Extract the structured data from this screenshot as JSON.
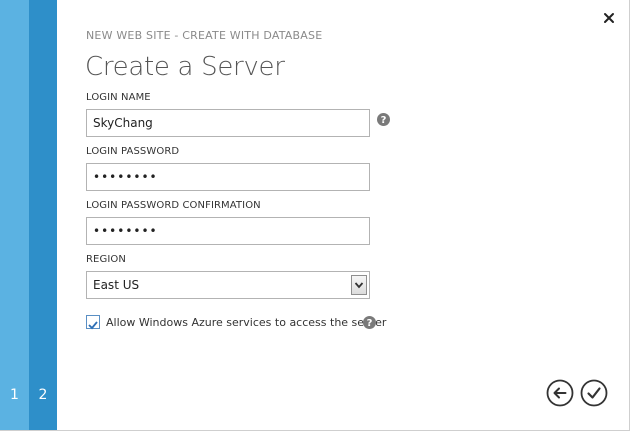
{
  "wizard": {
    "subtitle": "NEW WEB SITE - CREATE WITH DATABASE",
    "title": "Create a Server",
    "steps": [
      "1",
      "2"
    ],
    "current_step": "2"
  },
  "form": {
    "login_name": {
      "label": "LOGIN NAME",
      "value": "SkyChang"
    },
    "login_password": {
      "label": "LOGIN PASSWORD",
      "value": "••••••••"
    },
    "login_password_confirm": {
      "label": "LOGIN PASSWORD CONFIRMATION",
      "value": "••••••••"
    },
    "region": {
      "label": "REGION",
      "value": "East US"
    },
    "allow_azure": {
      "label": "Allow Windows Azure services to access the server",
      "checked": true
    }
  },
  "icons": {
    "close": "close-icon",
    "help": "help-icon",
    "back": "back-arrow-icon",
    "complete": "checkmark-icon"
  },
  "colors": {
    "step1": "#5bb2e2",
    "step2": "#2e8fc9",
    "accent": "#2e8fc9"
  }
}
